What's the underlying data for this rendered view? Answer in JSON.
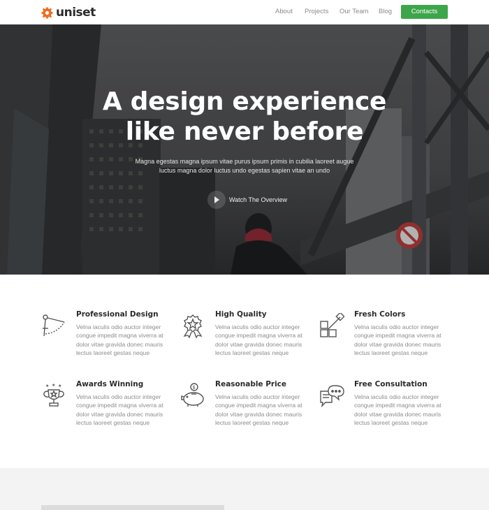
{
  "nav": {
    "brand": "uniset",
    "links": [
      "About",
      "Projects",
      "Our Team",
      "Blog"
    ],
    "cta": "Contacts"
  },
  "hero": {
    "title_line1": "A design experience",
    "title_line2": "like never before",
    "subtitle": "Magna egestas magna ipsum vitae purus ipsum primis in cubilia laoreet augue luctus magna dolor luctus undo egestas sapien vitae an undo",
    "watch_label": "Watch The Overview"
  },
  "features": [
    {
      "title": "Professional Design",
      "icon": "drafting-compass-icon",
      "desc": "Velna iaculis odio auctor integer congue impedit magna viverra at dolor vitae gravida donec mauris lectus laoreet gestas neque"
    },
    {
      "title": "High Quality",
      "icon": "award-badge-icon",
      "desc": "Velna iaculis odio auctor integer congue impedit magna viverra at dolor vitae gravida donec mauris lectus laoreet gestas neque"
    },
    {
      "title": "Fresh Colors",
      "icon": "color-picker-icon",
      "desc": "Velna iaculis odio auctor integer congue impedit magna viverra at dolor vitae gravida donec mauris lectus laoreet gestas neque"
    },
    {
      "title": "Awards Winning",
      "icon": "trophy-icon",
      "desc": "Velna iaculis odio auctor integer congue impedit magna viverra at dolor vitae gravida donec mauris lectus laoreet gestas neque"
    },
    {
      "title": "Reasonable Price",
      "icon": "piggy-bank-icon",
      "desc": "Velna iaculis odio auctor integer congue impedit magna viverra at dolor vitae gravida donec mauris lectus laoreet gestas neque"
    },
    {
      "title": "Free Consultation",
      "icon": "chat-bubbles-icon",
      "desc": "Velna iaculis odio auctor integer congue impedit magna viverra at dolor vitae gravida donec mauris lectus laoreet gestas neque"
    }
  ],
  "colors": {
    "brand_accent": "#f26b1d",
    "cta_green": "#3da649",
    "text_dark": "#2b2b2b",
    "text_muted": "#8c8c8c"
  }
}
